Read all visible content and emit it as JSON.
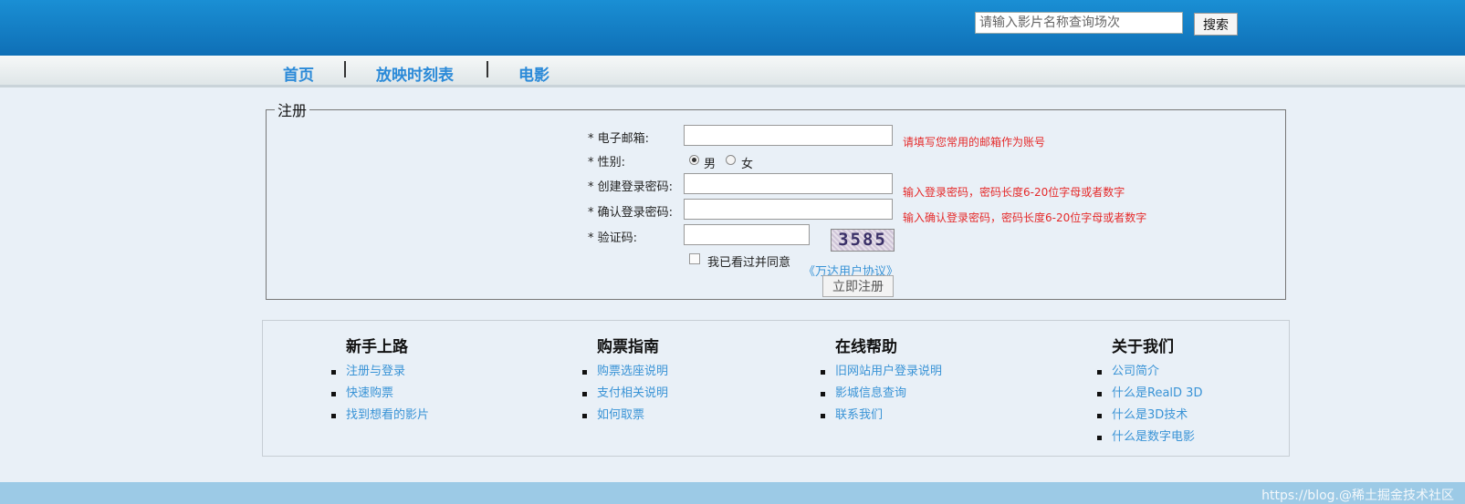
{
  "header": {
    "search_placeholder": "请输入影片名称查询场次",
    "search_button": "搜索"
  },
  "nav": {
    "items": [
      "首页",
      "放映时刻表",
      "电影"
    ]
  },
  "register": {
    "legend": "注册",
    "email_label": "* 电子邮箱:",
    "email_hint": "请填写您常用的邮箱作为账号",
    "gender_label": "* 性别:",
    "gender_male": "男",
    "gender_female": "女",
    "gender_selected": "男",
    "password_label": "* 创建登录密码:",
    "password_hint": "输入登录密码，密码长度6-20位字母或者数字",
    "confirm_label": "* 确认登录密码:",
    "confirm_hint": "输入确认登录密码，密码长度6-20位字母或者数字",
    "captcha_label": "* 验证码:",
    "captcha_text": "3585",
    "agree_text": "我已看过并同意",
    "agreement_link": "《万达用户协议》",
    "submit_button": "立即注册"
  },
  "footer": {
    "columns": [
      {
        "title": "新手上路",
        "links": [
          "注册与登录",
          "快速购票",
          "找到想看的影片"
        ]
      },
      {
        "title": "购票指南",
        "links": [
          "购票选座说明",
          "支付相关说明",
          "如何取票"
        ]
      },
      {
        "title": "在线帮助",
        "links": [
          "旧网站用户登录说明",
          "影城信息查询",
          "联系我们"
        ]
      },
      {
        "title": "关于我们",
        "links": [
          "公司简介",
          "什么是RealD 3D",
          "什么是3D技术",
          "什么是数字电影"
        ]
      }
    ]
  },
  "watermark": "https://blog.@稀土掘金技术社区",
  "colors": {
    "header_blue": "#1a8fd4",
    "link_blue": "#3993d6",
    "hint_red": "#e52a2a",
    "page_bg": "#e9f0f7"
  }
}
